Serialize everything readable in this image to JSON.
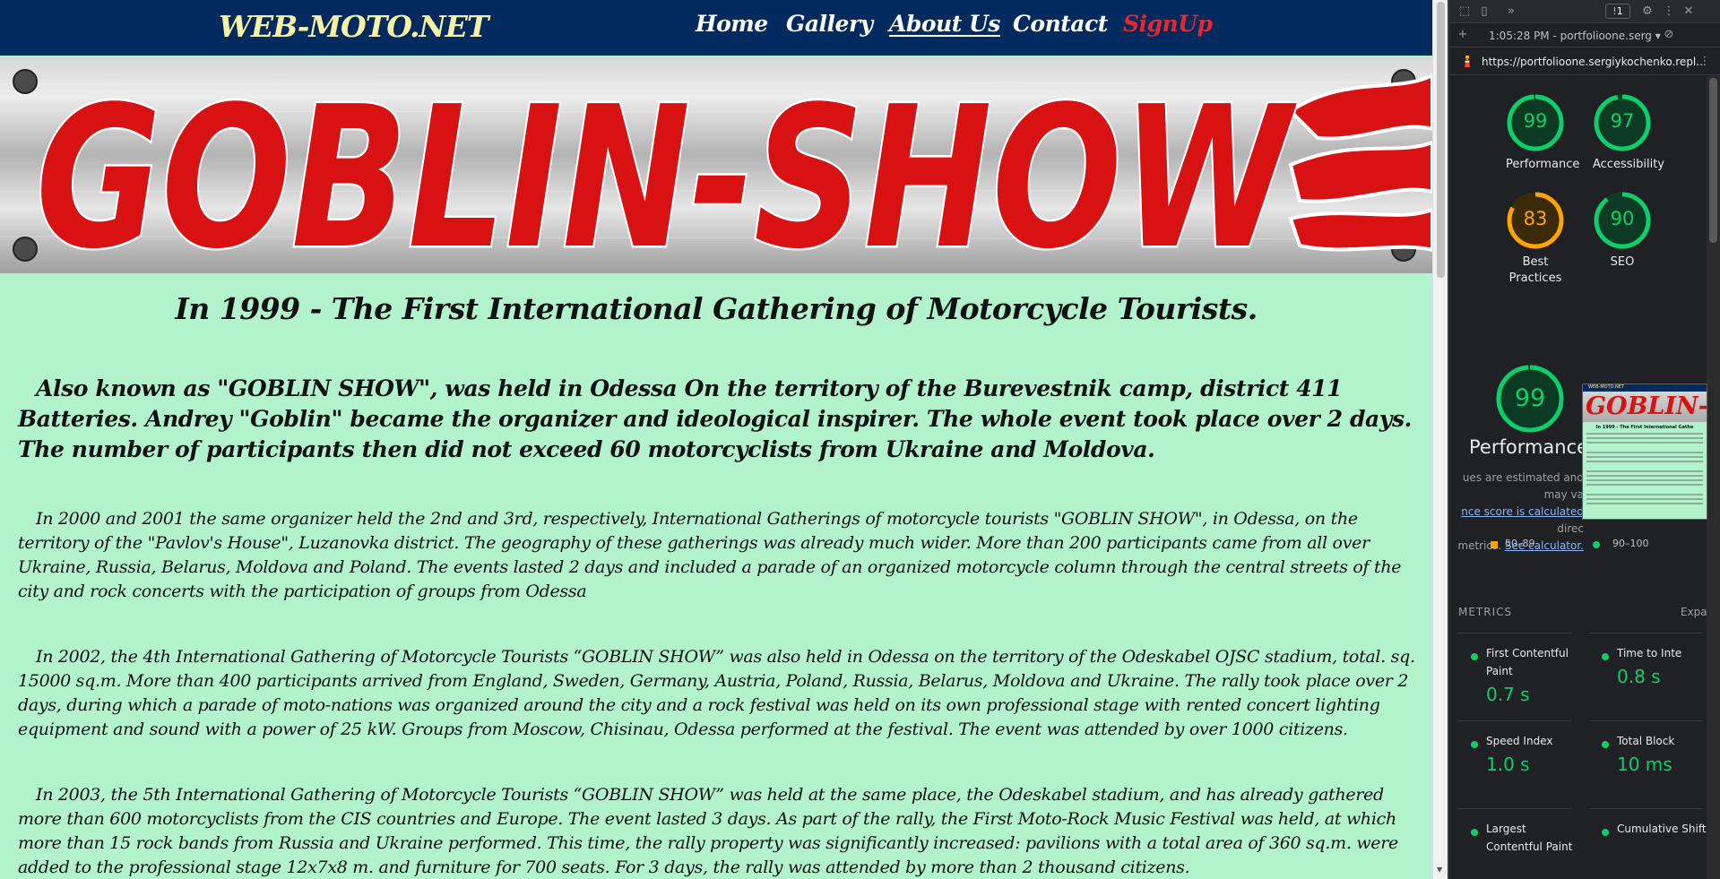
{
  "site": {
    "brand": "WEB-MOTO.NET",
    "nav": [
      "Home",
      "Gallery",
      "About Us",
      "Contact",
      "SignUp"
    ],
    "banner_text": "GOBLIN-SHOW",
    "heading": "In 1999 - The First International Gathering of Motorcycle Tourists.",
    "paragraphs": [
      "Also known as \"GOBLIN SHOW\", was held in Odessa On the territory of the Burevestnik camp, district 411 Batteries. Andrey \"Goblin\" became the organizer and ideological inspirer. The whole event took place over 2 days. The number of participants then did not exceed 60 motorcyclists from Ukraine and Moldova.",
      "In 2000 and 2001 the same organizer held the 2nd and 3rd, respectively, International Gatherings of motorcycle tourists \"GOBLIN SHOW\", in Odessa, on the territory of the \"Pavlov's House\", Luzanovka district. The geography of these gatherings was already much wider. More than 200 participants came from all over Ukraine, Russia, Belarus, Moldova and Poland. The events lasted 2 days and included a parade of an organized motorcycle column through the central streets of the city and rock concerts with the participation of groups from Odessa",
      "In 2002, the 4th International Gathering of Motorcycle Tourists “GOBLIN SHOW” was also held in Odessa on the territory of the Odeskabel OJSC stadium, total. sq. 15000 sq.m. More than 400 participants arrived from England, Sweden, Germany, Austria, Poland, Russia, Belarus, Moldova and Ukraine. The rally took place over 2 days, during which a parade of moto-nations was organized around the city and a rock festival was held on its own professional stage with rented concert lighting equipment and sound with a power of 25 kW. Groups from Moscow, Chisinau, Odessa performed at the festival. The event was attended by over 1000 citizens.",
      "In 2003, the 5th International Gathering of Motorcycle Tourists “GOBLIN SHOW” was held at the same place, the Odeskabel stadium, and has already gathered more than 600 motorcyclists from the CIS countries and Europe. The event lasted 3 days. As part of the rally, the First Moto-Rock Music Festival was held, at which more than 15 rock bands from Russia and Ukraine performed. This time, the rally property was significantly increased: pavilions with a total area of 360 sq.m. were added to the professional stage 12x7x8 m. and furniture for 700 seats. For 3 days, the rally was attended by more than 2 thousand citizens."
    ]
  },
  "devtools": {
    "warning_count": "1",
    "timestamp": "1:05:28 PM - portfolioone.serg",
    "url": "https://portfolioone.sergiykochenko.repl...",
    "scores": [
      {
        "label": "Performance",
        "value": 99,
        "color": "#0cce6b"
      },
      {
        "label": "Accessibility",
        "value": 97,
        "color": "#0cce6b"
      },
      {
        "label": "Best Practices",
        "value": 83,
        "color": "#ffa400"
      },
      {
        "label": "SEO",
        "value": 90,
        "color": "#0cce6b"
      }
    ],
    "main_score": {
      "label": "Performance",
      "value": 99
    },
    "note_prefix": "ues are estimated and may va",
    "note_link": "nce score is calculated",
    "note_mid": "direc",
    "note_suffix": "metrics.",
    "note_calc": "See calculator.",
    "screenshot_brand": "WEB-MOTO.NET",
    "screenshot_banner": "GOBLIN-S",
    "screenshot_title": "In 1999 - The First International Gathe",
    "legend": [
      {
        "label": "50–89",
        "color": "#ffa400"
      },
      {
        "label": "90–100",
        "color": "#0cce6b"
      }
    ],
    "metrics_header": "METRICS",
    "metrics_expand": "Expa",
    "metrics": [
      {
        "title": "First Contentful Paint",
        "value": "0.7 s"
      },
      {
        "title": "Time to Inte",
        "value": "0.8 s"
      },
      {
        "title": "Speed Index",
        "value": "1.0 s"
      },
      {
        "title": "Total Block",
        "value": "10 ms"
      },
      {
        "title": "Largest Contentful Paint",
        "value": ""
      },
      {
        "title": "Cumulative Shift",
        "value": ""
      }
    ]
  }
}
